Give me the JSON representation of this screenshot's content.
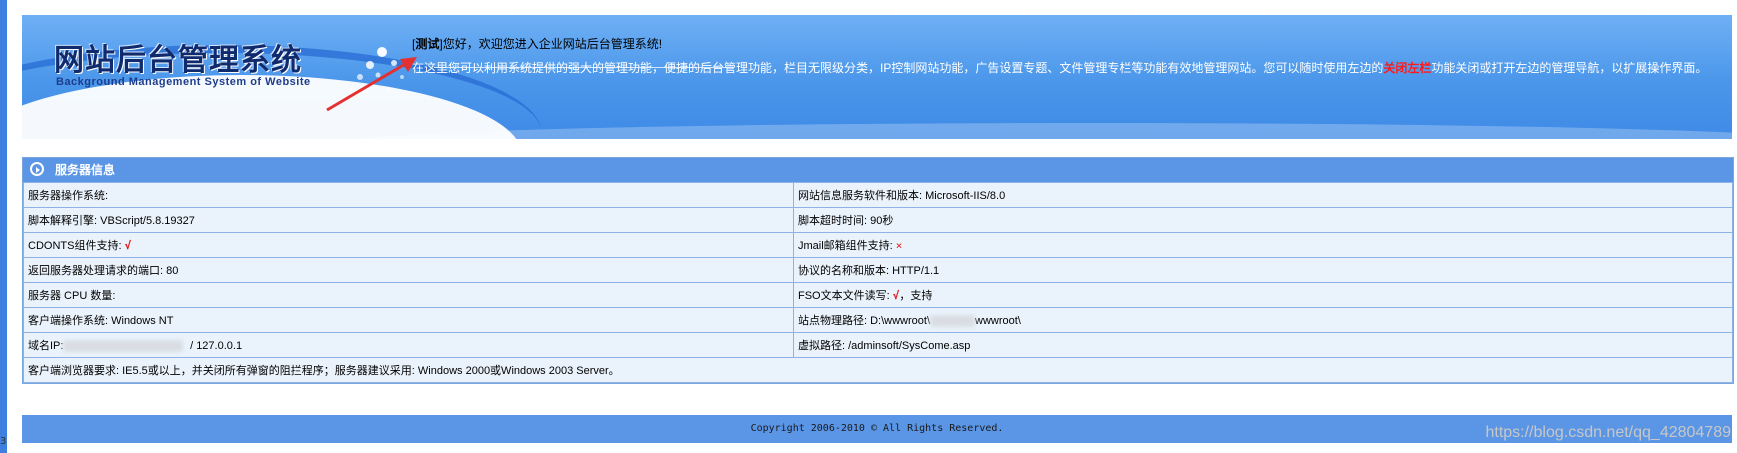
{
  "header": {
    "logo_cn": "网站后台管理系统",
    "logo_en": "Background Management System of Website",
    "welcome_prefix": "[",
    "username": "测试",
    "welcome_suffix": "]您好，欢迎您进入企业网站后台管理系统!",
    "intro_before": "在这里您可以利用系统提供的强大的管理功能，便捷的后台管理功能，栏目无限级分类，IP控制网站功能，广告设置专题、文件管理专栏等功能有效地管理网站。您可以随时使用左边的",
    "intro_highlight": "关闭左栏",
    "intro_after": "功能关闭或打开左边的管理导航，以扩展操作界面。"
  },
  "server_info": {
    "title": "服务器信息",
    "rows": [
      [
        "服务器操作系统:",
        "网站信息服务软件和版本: Microsoft-IIS/8.0"
      ],
      [
        "脚本解释引擎: VBScript/5.8.19327",
        "脚本超时时间: 90秒"
      ],
      [
        "CDONTS组件支持: ",
        "Jmail邮箱组件支持: "
      ],
      [
        "返回服务器处理请求的端口: 80",
        "协议的名称和版本: HTTP/1.1"
      ],
      [
        "服务器 CPU 数量:",
        "FSO文本文件读写: "
      ],
      [
        "客户端操作系统:  Windows NT",
        "站点物理路径: D:\\wwwroot\\"
      ],
      [
        "域名IP:",
        "虚拟路径: /adminsoft/SysCome.asp"
      ]
    ],
    "cdonts_mark": "√",
    "jmail_mark": "×",
    "fso_mark": "√",
    "fso_extra": "，支持",
    "path_tail": "wwwroot\\",
    "ip_tail": "/  127.0.0.1",
    "browser_req": "客户端浏览器要求:  IE5.5或以上，并关闭所有弹窗的阻拦程序；服务器建议采用: Windows 2000或Windows 2003 Server。"
  },
  "footer": {
    "copyright": "Copyright 2006-2010 © All Rights Reserved."
  },
  "watermark": "https://blog.csdn.net/qq_42804789",
  "corner_digit": "3",
  "colors": {
    "banner": "#4a96ea",
    "panel_header": "#5b96e6",
    "cell_bg": "#eaf3fc",
    "highlight_red": "#ff1a1a"
  }
}
